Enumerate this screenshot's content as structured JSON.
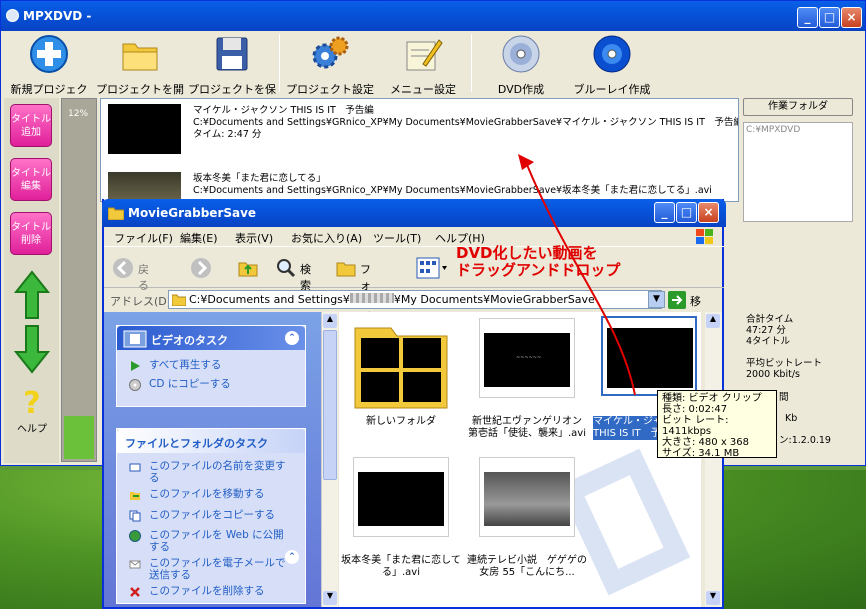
{
  "app": {
    "title": "MPXDVD -",
    "toolbar": [
      {
        "label": "新規プロジェクト",
        "icon": "new-project-icon"
      },
      {
        "label": "プロジェクトを開く",
        "icon": "open-folder-icon"
      },
      {
        "label": "プロジェクトを保存",
        "icon": "save-floppy-icon"
      },
      {
        "label": "プロジェクト設定",
        "icon": "gear-settings-icon"
      },
      {
        "label": "メニュー設定",
        "icon": "menu-edit-icon"
      },
      {
        "label": "DVD作成",
        "icon": "dvd-disc-icon"
      },
      {
        "label": "ブルーレイ作成",
        "icon": "bluray-disc-icon"
      }
    ],
    "side": {
      "add": "タイトル\n追加",
      "edit": "タイトル\n編集",
      "delete": "タイトル\n削除",
      "help": "ヘルプ"
    },
    "progress_label": "12%",
    "progress_fraction": 0.12,
    "items": [
      {
        "title": "マイケル・ジャクソン THIS IS IT　予告編",
        "path": "C:¥Documents and Settings¥GRnico_XP¥My Documents¥MovieGrabberSave¥マイケル・ジャクソン THIS IS IT　予告編",
        "time": "タイム: 2:47 分"
      },
      {
        "title": "坂本冬美「また君に恋してる」",
        "path": "C:¥Documents and Settings¥GRnico_XP¥My Documents¥MovieGrabberSave¥坂本冬美「また君に恋してる」.avi",
        "time": ""
      }
    ],
    "right": {
      "work_folder_button": "作業フォルダ",
      "work_folder_path": "C:¥MPXDVD",
      "total_time_label": "合計タイム",
      "total_time_value": "47:27 分",
      "title_count": "4タイトル",
      "avg_bitrate_label": "平均ビットレート",
      "avg_bitrate_value": "2000 Kbit/s",
      "frag1": "間",
      "frag2": "Kb",
      "version_frag": "ン:1.2.0.19"
    }
  },
  "explorer": {
    "title": "MovieGrabberSave",
    "menu": [
      "ファイル(F)",
      "編集(E)",
      "表示(V)",
      "お気に入り(A)",
      "ツール(T)",
      "ヘルプ(H)"
    ],
    "nav": {
      "back": "戻る",
      "search": "検索",
      "folder": "フォルダ"
    },
    "address_label": "アドレス(D)",
    "address_part1": "C:¥Documents and Settings¥",
    "address_part2": "¥My Documents¥MovieGrabberSave",
    "go": "移動",
    "video_tasks": {
      "title": "ビデオのタスク",
      "items": [
        "すべて再生する",
        "CD にコピーする"
      ]
    },
    "file_tasks": {
      "title": "ファイルとフォルダのタスク",
      "items": [
        "このファイルの名前を変更する",
        "このファイルを移動する",
        "このファイルをコピーする",
        "このファイルを Web に公開する",
        "このファイルを電子メールで送信する",
        "このファイルを削除する"
      ]
    },
    "files": [
      {
        "label": "新しいフォルダ"
      },
      {
        "label": "新世紀エヴァンゲリオン 第壱話「使徒、襲来」.avi"
      },
      {
        "label": "マイケル・ジャクソン THIS IS IT　予告"
      },
      {
        "label": "坂本冬美「また君に恋してる」.avi"
      },
      {
        "label": "連続テレビ小説　ゲゲゲの女房 55「こんにち..."
      }
    ],
    "tooltip": [
      "種類: ビデオ クリップ",
      "長さ: 0:02:47",
      "ビット レート: 1411kbps",
      "大きさ: 480 x 368",
      "サイズ: 34.1 MB"
    ]
  },
  "annotation": "DVD化したい動画を\nドラッグアンドドロップ",
  "colors": {
    "accent_pink": "#e0209a",
    "title_blue": "#0652d8",
    "annotation_red": "#e00000"
  }
}
